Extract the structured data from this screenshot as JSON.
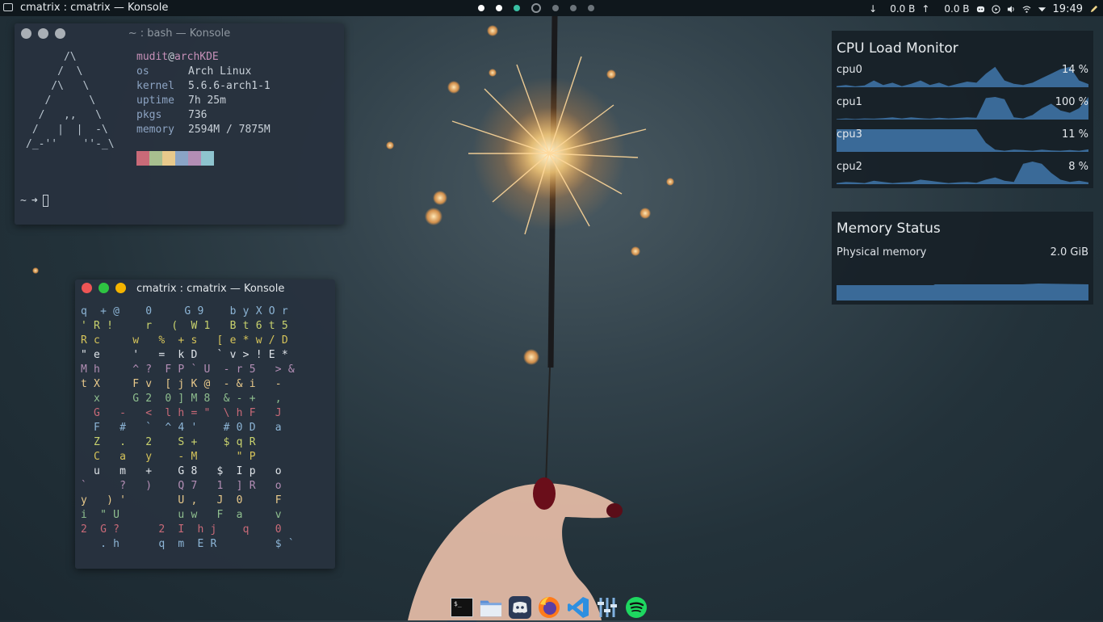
{
  "topbar": {
    "window_title": "cmatrix : cmatrix — Konsole",
    "net_down": "↓",
    "net_down_value": "0.0 B",
    "net_up": "↑",
    "net_up_value": "0.0 B",
    "clock": "19:49"
  },
  "bash_window": {
    "title": "~ : bash — Konsole",
    "ascii_logo": "      /\\\n     /  \\\n    /\\   \\\n   /      \\\n  /   ,,   \\\n /   |  |  -\\\n/_-''    ''-_\\",
    "user": "mudit",
    "at": "@",
    "host": "archKDE",
    "info": [
      {
        "key": "os",
        "value": "Arch Linux"
      },
      {
        "key": "kernel",
        "value": "5.6.6-arch1-1"
      },
      {
        "key": "uptime",
        "value": "7h 25m"
      },
      {
        "key": "pkgs",
        "value": "736"
      },
      {
        "key": "memory",
        "value": "2594M / 7875M"
      }
    ],
    "swatch_colors": [
      "#c96a78",
      "#a8bf8f",
      "#e8c98b",
      "#8aa4c6",
      "#b38eb5",
      "#8ec4cf"
    ],
    "prompt_path": "~",
    "prompt_arrow": "➜"
  },
  "matrix_window": {
    "title": "cmatrix : cmatrix — Konsole",
    "lines": [
      "q  + @    0     G 9    b y X O r",
      "' R !     r   (  W 1   B t 6 t 5",
      "R c     w   %  + s   [ e * w / D",
      "\" e     '   =  k D   ` v > ! E *",
      "M h     ^ ?  F P ` U  - r 5   > &",
      "t X     F v  [ j K @  - & i   -",
      "  x     G 2  0 ] M 8  & - +   ,",
      "  G   -   <  l h = \"  \\ h F   J",
      "  F   #   `  ^ 4 '    # 0 D   a",
      "  Z   .   2    S +    $ q R",
      "  C   a   y    - M      \" P",
      "  u   m   +    G 8   $  I p   o",
      "`     ?   )    Q 7   1  ] R   o",
      "y   ) '        U ,   J  0     F",
      "i  \" U         u w   F  a     v",
      "2  G ?      2  I  h j    q    0",
      "   . h      q  m  E R         $ `"
    ],
    "colors": [
      "#8db5d6",
      "#c9d36e",
      "#d6c45a",
      "#e0e5ea",
      "#b38eb5",
      "#e8c98b",
      "#8fbf8f",
      "#c96a78"
    ]
  },
  "cpu_widget": {
    "title": "CPU Load Monitor",
    "rows": [
      {
        "label": "cpu0",
        "value": "14 %",
        "load": 0.14
      },
      {
        "label": "cpu1",
        "value": "100 %",
        "load": 1.0
      },
      {
        "label": "cpu3",
        "value": "11 %",
        "load": 0.11
      },
      {
        "label": "cpu2",
        "value": "8 %",
        "load": 0.08
      }
    ],
    "graph_color": "#3a6a98"
  },
  "memory_widget": {
    "title": "Memory Status",
    "label": "Physical memory",
    "value": "2.0 GiB",
    "bar_color": "#3a6a98"
  },
  "dock": {
    "items": [
      {
        "name": "terminal-icon"
      },
      {
        "name": "files-icon"
      },
      {
        "name": "discord-icon"
      },
      {
        "name": "firefox-icon"
      },
      {
        "name": "vscode-icon"
      },
      {
        "name": "mixer-icon"
      },
      {
        "name": "spotify-icon"
      }
    ]
  }
}
